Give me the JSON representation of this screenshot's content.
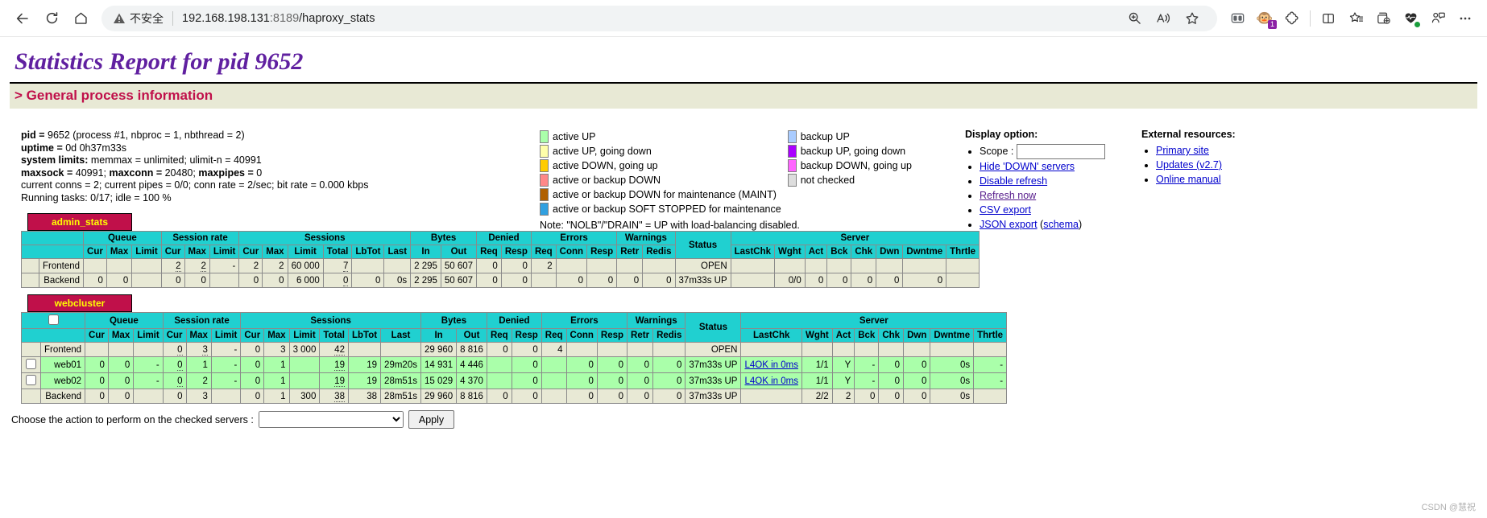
{
  "browser": {
    "back_label": "Back",
    "reload_label": "Refresh",
    "home_label": "Home",
    "security_label": "不安全",
    "url_host": "192.168.198.131",
    "url_port": ":8189",
    "url_path": "/haproxy_stats",
    "zoom_label": "Zoom",
    "read_aloud_label": "Read aloud",
    "favorite_label": "Add to favorites",
    "split_screen_label": "Split screen",
    "extension_badge": "1",
    "more_label": "Settings and more"
  },
  "page": {
    "title": "Statistics Report for pid 9652",
    "section_heading": "> General process information",
    "watermark": "CSDN @慧祝"
  },
  "process_info": [
    {
      "label": "pid = ",
      "value": "9652 (process #1, nbproc = 1, nbthread = 2)"
    },
    {
      "label": "uptime = ",
      "value": "0d 0h37m33s"
    },
    {
      "label": "system limits: ",
      "value": "memmax = unlimited; ulimit-n = 40991"
    },
    {
      "label": "maxsock = ",
      "value": "40991; maxconn = 20480; maxpipes = 0"
    },
    {
      "label": "",
      "value": "current conns = 2; current pipes = 0/0; conn rate = 2/sec; bit rate = 0.000 kbps"
    },
    {
      "label": "",
      "value": "Running tasks: 0/17; idle = 100 %"
    }
  ],
  "process_info_bold": {
    "line4_parts": [
      "maxsock = ",
      "40991; ",
      "maxconn = ",
      "20480; ",
      "maxpipes = ",
      "0"
    ]
  },
  "legend": {
    "left": [
      {
        "color": "#aaffaa",
        "label": "active UP"
      },
      {
        "color": "#ffffaa",
        "label": "active UP, going down"
      },
      {
        "color": "#ffcc00",
        "label": "active DOWN, going up"
      },
      {
        "color": "#ff8888",
        "label": "active or backup DOWN"
      },
      {
        "color": "#b06000",
        "label": "active or backup DOWN for maintenance (MAINT)"
      },
      {
        "color": "#30a0e0",
        "label": "active or backup SOFT STOPPED for maintenance"
      }
    ],
    "right": [
      {
        "color": "#aaccff",
        "label": "backup UP"
      },
      {
        "color": "#aa00ff",
        "label": "backup UP, going down"
      },
      {
        "color": "#ff66ff",
        "label": "backup DOWN, going up"
      },
      {
        "color": "#dddddd",
        "label": "not checked"
      }
    ],
    "note": "Note: \"NOLB\"/\"DRAIN\" = UP with load-balancing disabled."
  },
  "display_option": {
    "title": "Display option:",
    "scope_label": "Scope :",
    "scope_value": "",
    "scope_placeholder": "",
    "links": [
      "Hide 'DOWN' servers",
      "Disable refresh",
      "Refresh now",
      "CSV export",
      "JSON export"
    ],
    "json_schema_prefix": "(",
    "json_schema_link": "schema",
    "json_schema_suffix": ")"
  },
  "external_resources": {
    "title": "External resources:",
    "links": [
      "Primary site",
      "Updates (v2.7)",
      "Online manual"
    ]
  },
  "table_headers": {
    "groups": [
      {
        "label": "",
        "span": 1
      },
      {
        "label": "Queue",
        "span": 3
      },
      {
        "label": "Session rate",
        "span": 3
      },
      {
        "label": "Sessions",
        "span": 6
      },
      {
        "label": "Bytes",
        "span": 2
      },
      {
        "label": "Denied",
        "span": 2
      },
      {
        "label": "Errors",
        "span": 3
      },
      {
        "label": "Warnings",
        "span": 2
      },
      {
        "label": "Status",
        "span": 1
      },
      {
        "label": "Server",
        "span": 8
      }
    ],
    "cols": [
      "",
      "Cur",
      "Max",
      "Limit",
      "Cur",
      "Max",
      "Limit",
      "Cur",
      "Max",
      "Limit",
      "Total",
      "LbTot",
      "Last",
      "In",
      "Out",
      "Req",
      "Resp",
      "Req",
      "Conn",
      "Resp",
      "Retr",
      "Redis",
      "",
      "LastChk",
      "Wght",
      "Act",
      "Bck",
      "Chk",
      "Dwn",
      "Dwntme",
      "Thrtle"
    ]
  },
  "proxies": [
    {
      "name": "admin_stats",
      "has_checkboxes": false,
      "rows": [
        {
          "type": "frontend",
          "name": "Frontend",
          "cells": [
            "",
            "",
            "",
            "2",
            "2",
            "-",
            "2",
            "2",
            "60 000",
            "7",
            "",
            "",
            "2 295",
            "50 607",
            "0",
            "0",
            "2",
            "",
            "",
            "",
            "",
            "OPEN",
            "",
            "",
            "",
            "",
            "",
            "",
            "",
            ""
          ],
          "underlined": [
            3,
            4,
            9
          ]
        },
        {
          "type": "backend",
          "name": "Backend",
          "cells": [
            "0",
            "0",
            "",
            "0",
            "0",
            "",
            "0",
            "0",
            "6 000",
            "0",
            "0",
            "0s",
            "2 295",
            "50 607",
            "0",
            "0",
            "",
            "0",
            "0",
            "0",
            "0",
            "37m33s UP",
            "",
            "0/0",
            "0",
            "0",
            "0",
            "0",
            "0",
            ""
          ],
          "underlined": [
            9
          ]
        }
      ]
    },
    {
      "name": "webcluster",
      "has_checkboxes": true,
      "rows": [
        {
          "type": "frontend",
          "name": "Frontend",
          "checkbox": null,
          "cells": [
            "",
            "",
            "",
            "0",
            "3",
            "-",
            "0",
            "3",
            "3 000",
            "42",
            "",
            "",
            "29 960",
            "8 816",
            "0",
            "0",
            "4",
            "",
            "",
            "",
            "",
            "OPEN",
            "",
            "",
            "",
            "",
            "",
            "",
            "",
            ""
          ],
          "underlined": [
            3,
            4,
            9
          ]
        },
        {
          "type": "server-up",
          "name": "web01",
          "checkbox": false,
          "cells": [
            "0",
            "0",
            "-",
            "0",
            "1",
            "-",
            "0",
            "1",
            "",
            "19",
            "19",
            "29m20s",
            "14 931",
            "4 446",
            "",
            "0",
            "",
            "0",
            "0",
            "0",
            "0",
            "37m33s UP",
            "L4OK in 0ms",
            "1/1",
            "Y",
            "-",
            "0",
            "0",
            "0s",
            "-"
          ],
          "underlined": [
            3,
            9
          ],
          "lastchk_link": true
        },
        {
          "type": "server-up",
          "name": "web02",
          "checkbox": false,
          "cells": [
            "0",
            "0",
            "-",
            "0",
            "2",
            "-",
            "0",
            "1",
            "",
            "19",
            "19",
            "28m51s",
            "15 029",
            "4 370",
            "",
            "0",
            "",
            "0",
            "0",
            "0",
            "0",
            "37m33s UP",
            "L4OK in 0ms",
            "1/1",
            "Y",
            "-",
            "0",
            "0",
            "0s",
            "-"
          ],
          "underlined": [
            3,
            9
          ],
          "lastchk_link": true
        },
        {
          "type": "backend",
          "name": "Backend",
          "checkbox": null,
          "cells": [
            "0",
            "0",
            "",
            "0",
            "3",
            "",
            "0",
            "1",
            "300",
            "38",
            "38",
            "28m51s",
            "29 960",
            "8 816",
            "0",
            "0",
            "",
            "0",
            "0",
            "0",
            "0",
            "37m33s UP",
            "",
            "2/2",
            "2",
            "0",
            "0",
            "0",
            "0s",
            ""
          ],
          "underlined": [
            9
          ]
        }
      ]
    }
  ],
  "action_bar": {
    "label": "Choose the action to perform on the checked servers :",
    "selected_option": "",
    "options": [
      ""
    ],
    "apply_label": "Apply"
  }
}
